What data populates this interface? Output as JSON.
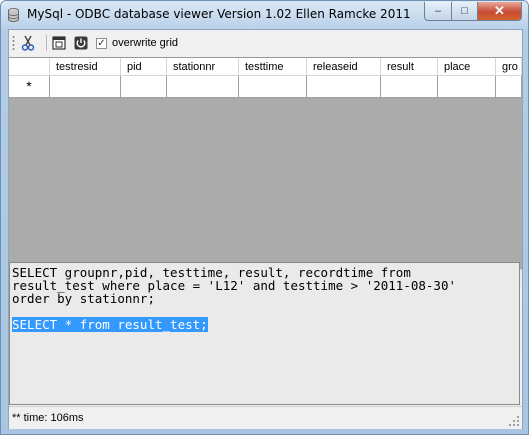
{
  "window": {
    "title": "MySql - ODBC database viewer  Version 1.02 Ellen Ramcke 2011"
  },
  "titlebar_buttons": {
    "minimize": "–",
    "maximize": "□",
    "close": "✕"
  },
  "toolbar": {
    "cut_icon": "scissors-icon",
    "window_icon": "window-icon",
    "power_icon": "power-icon",
    "checkbox_checked": true,
    "checkbox_mark": "✓",
    "checkbox_label": "overwrite grid"
  },
  "grid": {
    "new_row_marker": "*",
    "columns": [
      "testresid",
      "pid",
      "stationnr",
      "testtime",
      "releaseid",
      "result",
      "place",
      "gro"
    ]
  },
  "scrollbar": {
    "left_arrow": "◄",
    "right_arrow": "►",
    "thumb_grip": "|||"
  },
  "sql": {
    "line1": "SELECT groupnr,pid, testtime, result, recordtime from",
    "line2": "result_test where place = 'L12' and testtime > '2011-08-30'",
    "line3": "order by stationnr;",
    "line4": "",
    "selected_line": "SELECT * from result_test;"
  },
  "status": {
    "text": "** time: 106ms"
  }
}
